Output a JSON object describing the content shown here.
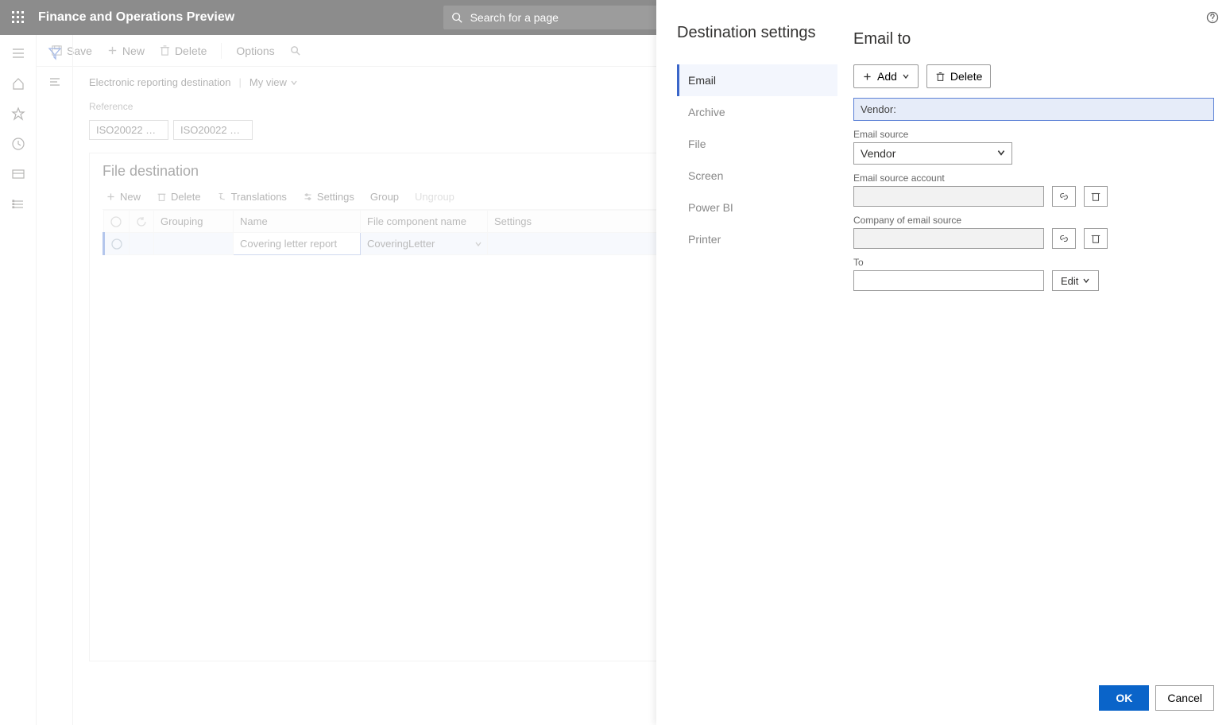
{
  "topbar": {
    "title": "Finance and Operations Preview",
    "search_placeholder": "Search for a page"
  },
  "actionbar": {
    "save": "Save",
    "new": "New",
    "delete": "Delete",
    "options": "Options"
  },
  "breadcrumb": {
    "page": "Electronic reporting destination",
    "view": "My view"
  },
  "reference": {
    "label": "Reference",
    "pills": [
      "ISO20022 Cre…",
      "ISO20022 Cre…"
    ]
  },
  "file_dest": {
    "title": "File destination",
    "toolbar": {
      "new": "New",
      "delete": "Delete",
      "translations": "Translations",
      "settings": "Settings",
      "group": "Group",
      "ungroup": "Ungroup"
    },
    "columns": {
      "grouping": "Grouping",
      "name": "Name",
      "component": "File component name",
      "settings": "Settings"
    },
    "rows": [
      {
        "grouping": "",
        "name": "Covering letter report",
        "component": "CoveringLetter",
        "settings": ""
      }
    ]
  },
  "dest_panel": {
    "title": "Destination settings",
    "items": [
      "Email",
      "Archive",
      "File",
      "Screen",
      "Power BI",
      "Printer"
    ]
  },
  "email_to": {
    "title": "Email to",
    "add": "Add",
    "delete": "Delete",
    "display_value": "Vendor:",
    "labels": {
      "email_source": "Email source",
      "email_source_account": "Email source account",
      "company": "Company of email source",
      "to": "To"
    },
    "email_source_value": "Vendor",
    "edit": "Edit",
    "ok": "OK",
    "cancel": "Cancel"
  }
}
